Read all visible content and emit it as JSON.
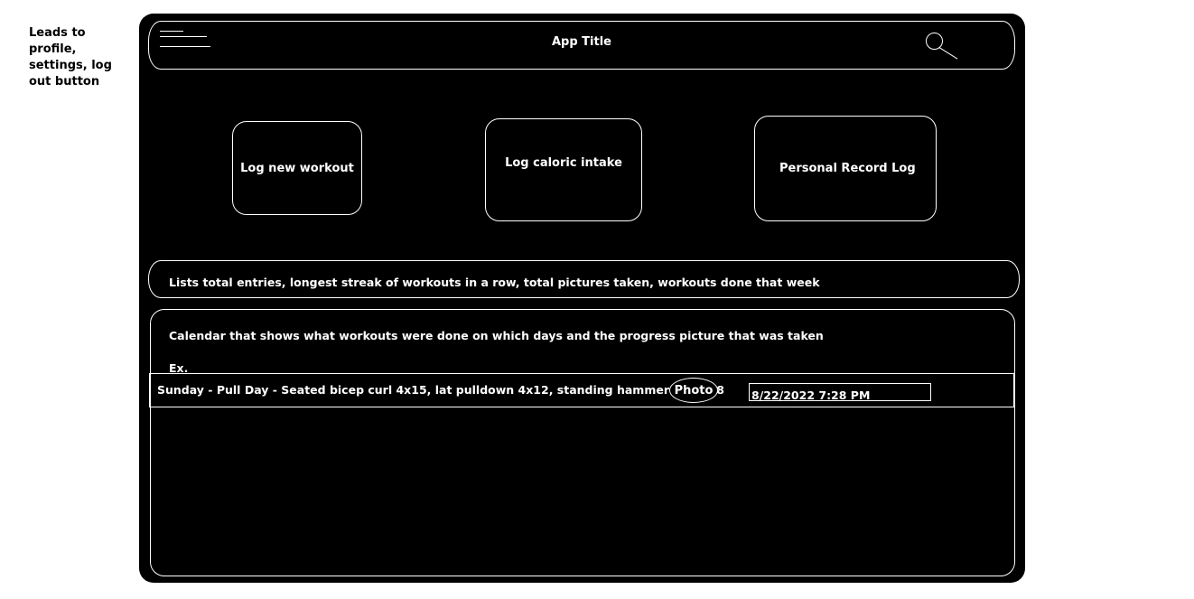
{
  "annotation": {
    "menu_note": "Leads to profile, settings, log out button"
  },
  "header": {
    "title": "App Title",
    "menu_icon": "hamburger-menu-icon",
    "search_icon": "search-icon"
  },
  "actions": {
    "log_workout": "Log new workout",
    "log_calories": "Log caloric intake",
    "personal_record": "Personal Record Log"
  },
  "stats": {
    "description": "Lists total entries, longest streak of workouts in a row, total pictures taken, workouts done that week"
  },
  "calendar": {
    "description": "Calendar that shows what workouts were done on which days and the progress picture that was taken",
    "example_label": "Ex.",
    "entries": [
      {
        "text": "Sunday  - Pull Day - Seated bicep curl 4x15, lat pulldown 4x12,  standing hammer curl 3x8",
        "photo_label": "Photo",
        "timestamp": "8/22/2022 7:28 PM"
      }
    ]
  },
  "colors": {
    "background": "#000000",
    "foreground": "#ffffff",
    "page": "#ffffff"
  }
}
